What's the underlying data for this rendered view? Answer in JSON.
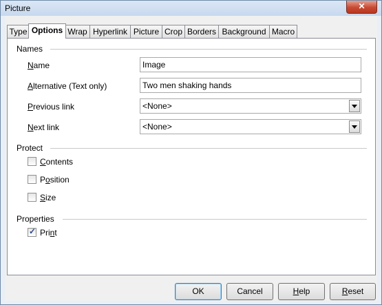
{
  "window": {
    "title": "Picture",
    "close_glyph": "✕"
  },
  "tabs": [
    {
      "label": "Type"
    },
    {
      "label": "Options"
    },
    {
      "label": "Wrap"
    },
    {
      "label": "Hyperlink"
    },
    {
      "label": "Picture"
    },
    {
      "label": "Crop"
    },
    {
      "label": "Borders"
    },
    {
      "label": "Background"
    },
    {
      "label": "Macro"
    }
  ],
  "names": {
    "title": "Names",
    "name_label_u": "N",
    "name_label_rest": "ame",
    "name_value": "Image",
    "alt_label_u": "A",
    "alt_label_rest": "lternative (Text only)",
    "alt_value": "Two men shaking hands",
    "prev_label_u": "P",
    "prev_label_rest": "revious link",
    "prev_value": "<None>",
    "next_label_u": "N",
    "next_label_rest": "ext link",
    "next_value": "<None>"
  },
  "protect": {
    "title": "Protect",
    "contents_u": "C",
    "contents_rest": "ontents",
    "contents_checked": false,
    "position_pre": "P",
    "position_u": "o",
    "position_rest": "sition",
    "position_checked": false,
    "size_u": "S",
    "size_rest": "ize",
    "size_checked": false
  },
  "properties": {
    "title": "Properties",
    "print_pre": "Pri",
    "print_u": "n",
    "print_rest": "t",
    "print_checked": true,
    "check_glyph": "✓"
  },
  "buttons": {
    "ok": "OK",
    "cancel": "Cancel",
    "help_u": "H",
    "help_rest": "elp",
    "reset_u": "R",
    "reset_rest": "eset"
  }
}
